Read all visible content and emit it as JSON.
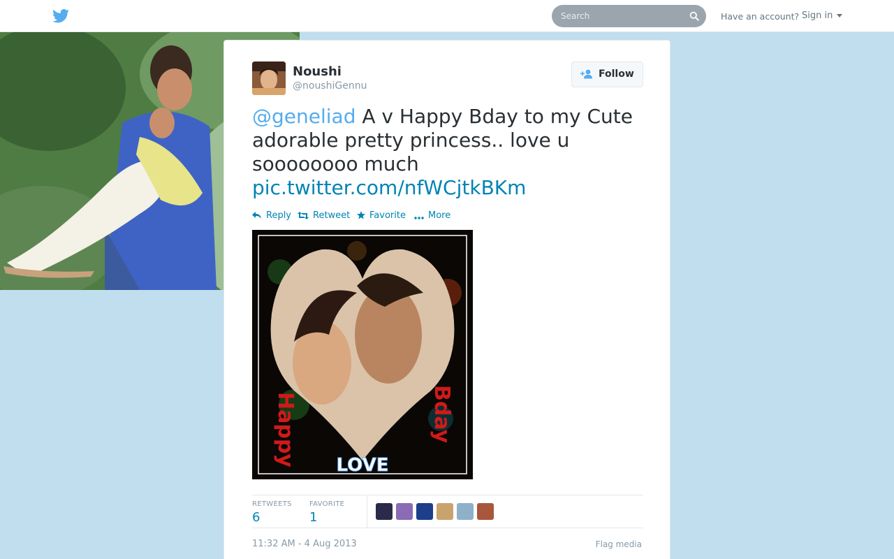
{
  "header": {
    "search_placeholder": "Search",
    "have_account": "Have an account?",
    "sign_in": "Sign in"
  },
  "tweet": {
    "author": {
      "name": "Noushi",
      "handle": "@noushiGennu"
    },
    "follow_label": "Follow",
    "text": {
      "mention": "@geneliad",
      "body": " A v Happy Bday to my Cute adorable pretty princess.. love u soooooooo much ",
      "link": "pic.twitter.com/nfWCjtkBKm"
    },
    "actions": {
      "reply": "Reply",
      "retweet": "Retweet",
      "favorite": "Favorite",
      "more": "More"
    },
    "media_text": {
      "left": "Happy",
      "right": "Bday",
      "bottom": "LOVE"
    },
    "stats": {
      "retweets_label": "RETWEETS",
      "retweets_value": "6",
      "favorites_label": "FAVORITE",
      "favorites_value": "1"
    },
    "timestamp": "11:32 AM - 4 Aug 2013",
    "flag_media": "Flag media"
  },
  "colors": {
    "brand": "#55acee",
    "link": "#0084b4",
    "background": "#c0deed"
  }
}
